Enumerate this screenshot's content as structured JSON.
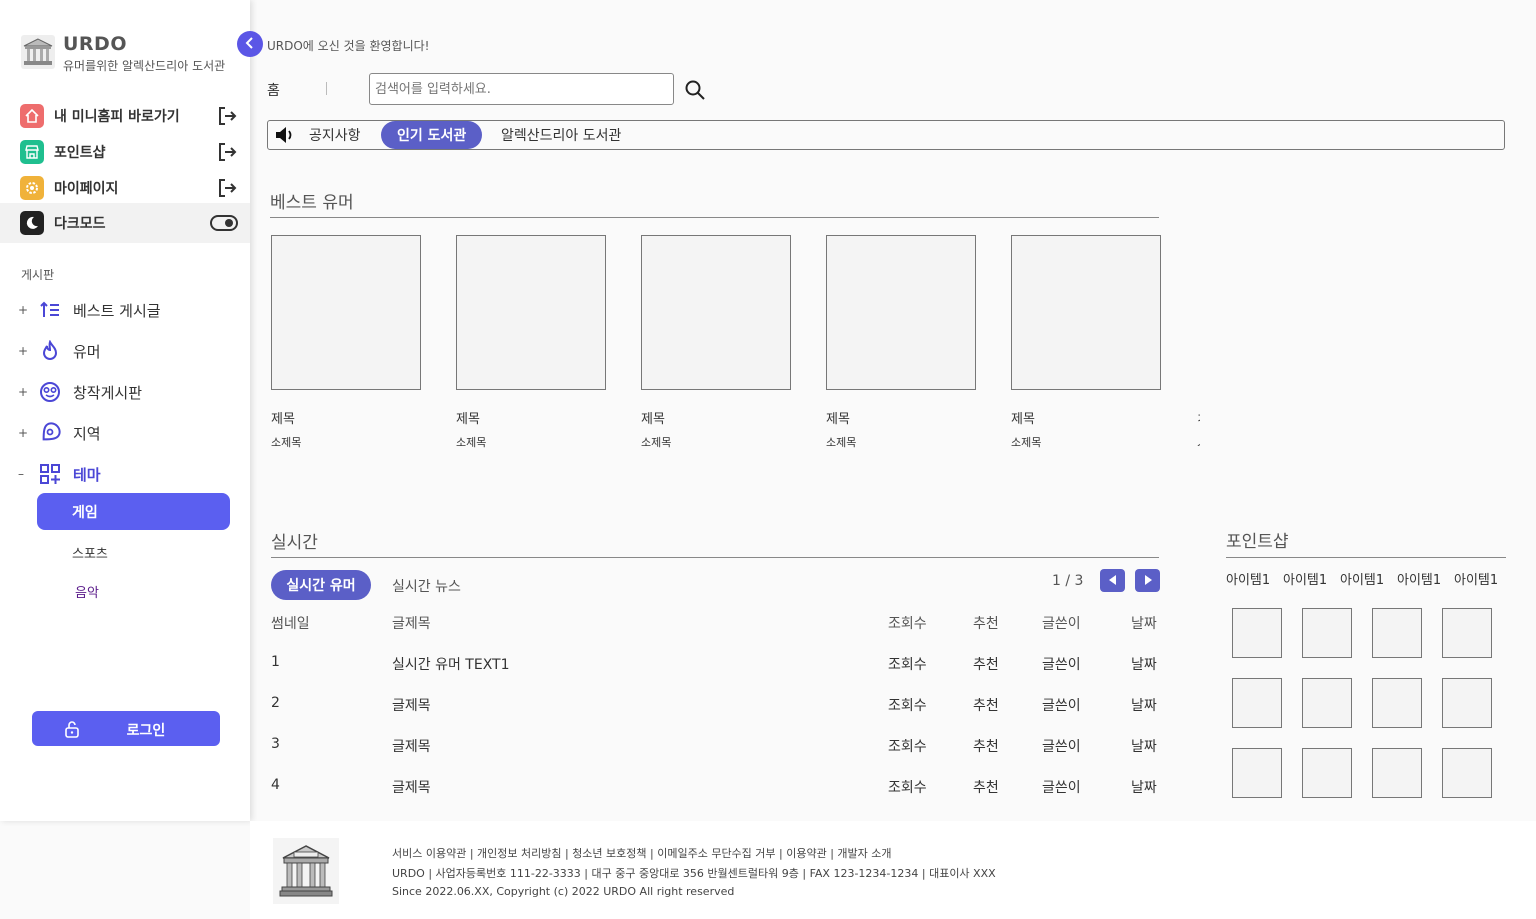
{
  "brand": {
    "title": "URDO",
    "subtitle": "유머를위한 알렉산드리아 도서관"
  },
  "quick_links": [
    {
      "label": "내 미니홈피 바로가기",
      "color": "#ee6d6d",
      "icon": "home-icon"
    },
    {
      "label": "포인트샵",
      "color": "#1fbf8f",
      "icon": "store-icon"
    },
    {
      "label": "마이페이지",
      "color": "#f0b23a",
      "icon": "gear-icon"
    },
    {
      "label": "다크모드",
      "color": "#222222",
      "icon": "moon-icon"
    }
  ],
  "board": {
    "section_label": "게시판",
    "items": [
      {
        "prefix": "+",
        "label": "베스트 게시글",
        "icon": "sort-list-icon"
      },
      {
        "prefix": "+",
        "label": "유머",
        "icon": "flame-icon"
      },
      {
        "prefix": "+",
        "label": "창작게시판",
        "icon": "smile-glasses-icon"
      },
      {
        "prefix": "+",
        "label": "지역",
        "icon": "location-pin-icon"
      },
      {
        "prefix": "–",
        "label": "테마",
        "icon": "grid-plus-icon"
      }
    ],
    "sub_items": [
      {
        "label": "게임"
      },
      {
        "label": "스포츠"
      },
      {
        "label": "음악"
      }
    ]
  },
  "login": {
    "label": "로그인"
  },
  "header": {
    "welcome": "URDO에 오신 것을 환영합니다!",
    "home": "홈",
    "search_placeholder": "검색어를 입력하세요."
  },
  "notice_tabs": [
    {
      "label": "공지사항",
      "active": false
    },
    {
      "label": "인기 도서관",
      "active": true
    },
    {
      "label": "알렉산드리아 도서관",
      "active": false
    }
  ],
  "best_humor": {
    "title": "베스트 유머",
    "cards": [
      {
        "title": "제목",
        "subtitle": "소제목"
      },
      {
        "title": "제목",
        "subtitle": "소제목"
      },
      {
        "title": "제목",
        "subtitle": "소제목"
      },
      {
        "title": "제목",
        "subtitle": "소제목"
      },
      {
        "title": "제목",
        "subtitle": "소제목"
      }
    ]
  },
  "realtime": {
    "title": "실시간",
    "tabs": [
      "실시간 유머",
      "실시간 뉴스"
    ],
    "pager": "1 / 3",
    "columns": [
      "썸네일",
      "글제목",
      "조회수",
      "추천",
      "글쓴이",
      "날짜"
    ],
    "rows": [
      [
        "1",
        "실시간 유머 TEXT1",
        "조회수",
        "추천",
        "글쓴이",
        "날짜"
      ],
      [
        "2",
        "글제목",
        "조회수",
        "추천",
        "글쓴이",
        "날짜"
      ],
      [
        "3",
        "글제목",
        "조회수",
        "추천",
        "글쓴이",
        "날짜"
      ],
      [
        "4",
        "글제목",
        "조회수",
        "추천",
        "글쓴이",
        "날짜"
      ]
    ]
  },
  "point_shop": {
    "title": "포인트샵",
    "items": [
      "아이템1",
      "아이템1",
      "아이템1",
      "아이템1",
      "아이템1"
    ]
  },
  "footer": {
    "links": "서비스 이용약관 | 개인정보 처리방침 | 청소년 보호정책 | 이메일주소 무단수집 거부 | 이용약관 | 개발자 소개",
    "company": "URDO | 사업자등록번호 111-22-3333 | 대구 중구 중앙대로 356 반월센트럴타워 9층 | FAX 123-1234-1234 | 대표이사 XXX",
    "copyright": "Since 2022.06.XX, Copyright (c) 2022 URDO All right reserved"
  },
  "colors": {
    "accent": "#5b5ff0",
    "accent_dark": "#5b5fc7"
  }
}
